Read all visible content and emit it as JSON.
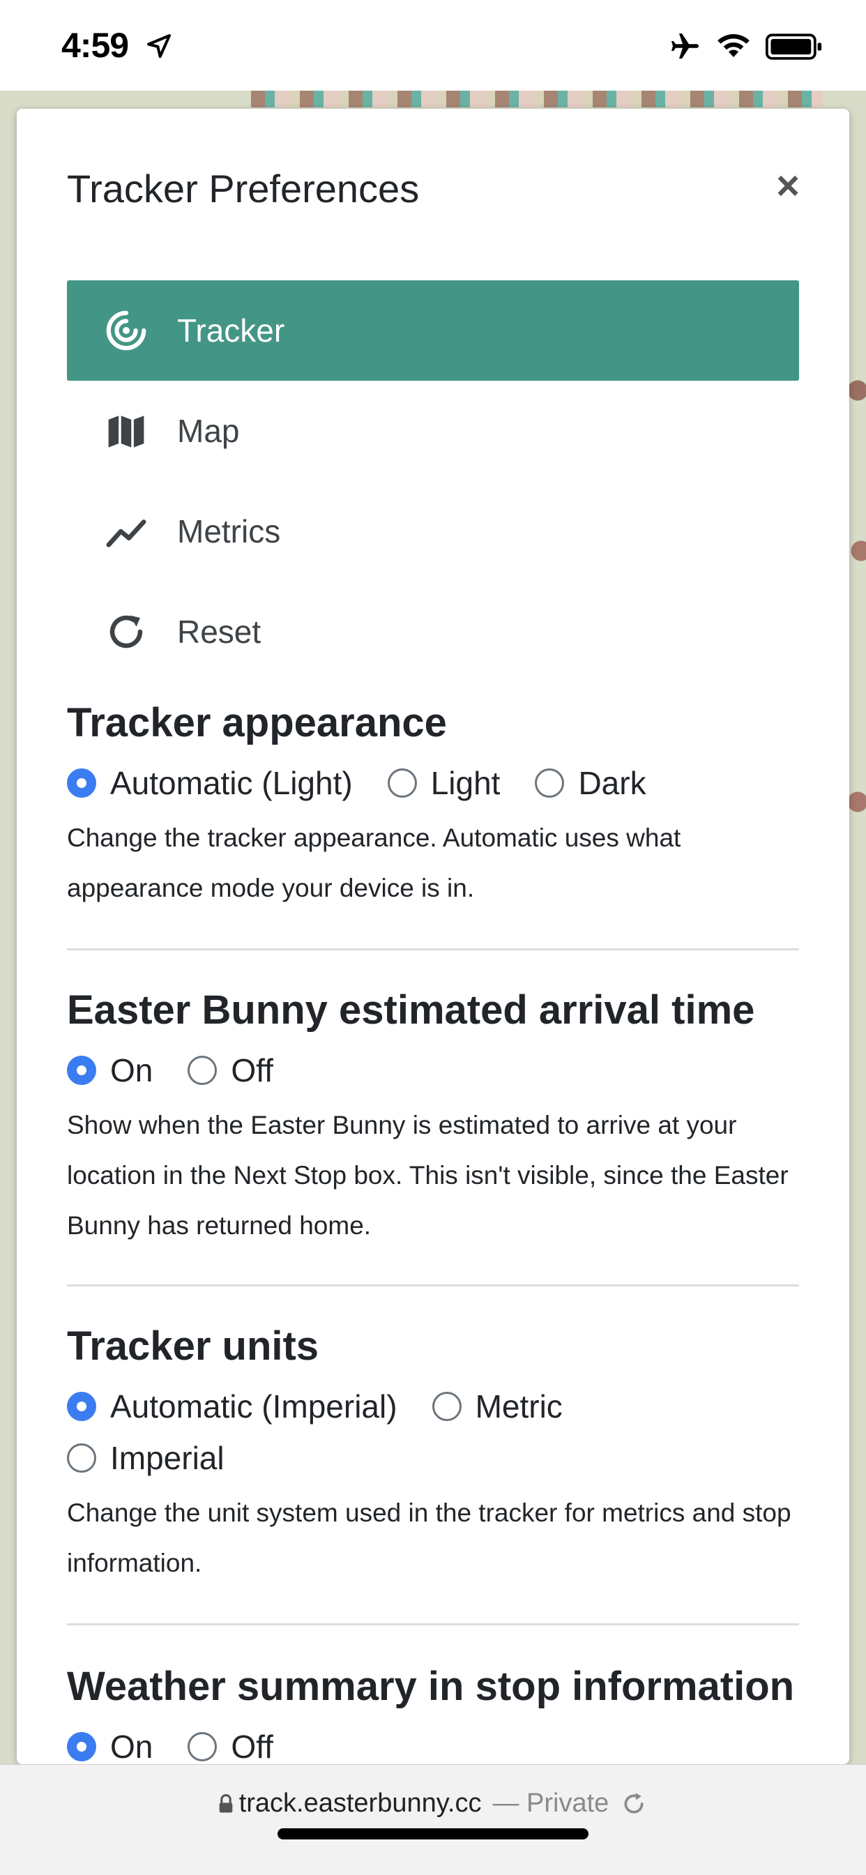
{
  "status_bar": {
    "time": "4:59"
  },
  "modal": {
    "title": "Tracker Preferences",
    "close_label": "×",
    "nav": [
      {
        "label": "Tracker",
        "icon": "tracker-target-icon",
        "active": true
      },
      {
        "label": "Map",
        "icon": "map-icon",
        "active": false
      },
      {
        "label": "Metrics",
        "icon": "chart-line-icon",
        "active": false
      },
      {
        "label": "Reset",
        "icon": "reset-icon",
        "active": false
      }
    ],
    "sections": {
      "appearance": {
        "title": "Tracker appearance",
        "options": [
          "Automatic (Light)",
          "Light",
          "Dark"
        ],
        "selected": "Automatic (Light)",
        "description": "Change the tracker appearance. Automatic uses what appearance mode your device is in."
      },
      "arrival": {
        "title": "Easter Bunny estimated arrival time",
        "options": [
          "On",
          "Off"
        ],
        "selected": "On",
        "description": "Show when the Easter Bunny is estimated to arrive at your location in the Next Stop box. This isn't visible, since the Easter Bunny has returned home."
      },
      "units": {
        "title": "Tracker units",
        "options": [
          "Automatic (Imperial)",
          "Metric",
          "Imperial"
        ],
        "selected": "Automatic (Imperial)",
        "description": "Change the unit system used in the tracker for metrics and stop information."
      },
      "weather": {
        "title": "Weather summary in stop information",
        "options": [
          "On",
          "Off"
        ],
        "selected": "On"
      }
    }
  },
  "browser": {
    "url": "track.easterbunny.cc",
    "private_label": "— Private"
  },
  "colors": {
    "accent": "#439585",
    "radio_selected": "#3b7cf1"
  }
}
